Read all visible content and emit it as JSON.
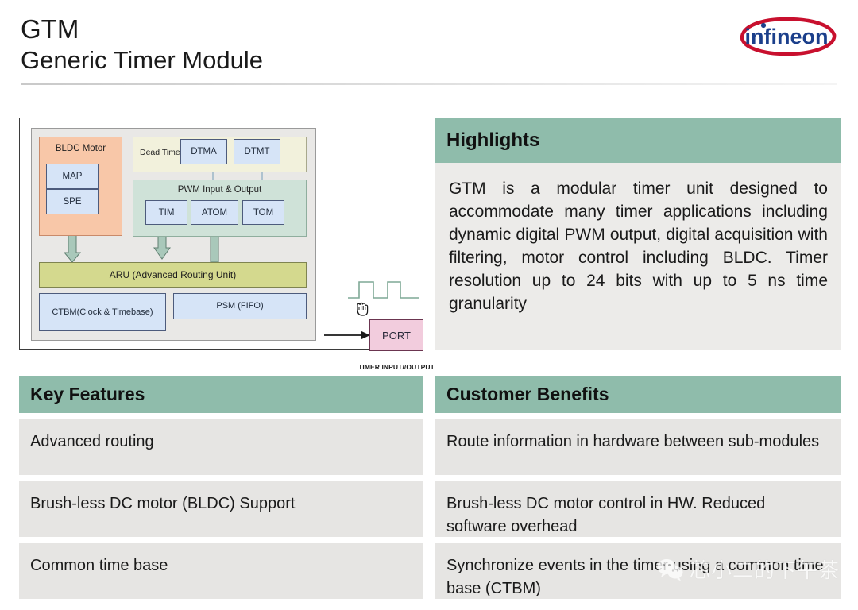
{
  "header": {
    "title_line1": "GTM",
    "title_line2": "Generic Timer Module",
    "logo_text": "infineon"
  },
  "diagram": {
    "bldc_group_label": "BLDC Motor",
    "map_label": "MAP",
    "spe_label": "SPE",
    "deadtime_label": "Dead Time",
    "dtma_label": "DTMA",
    "dtmt_label": "DTMT",
    "pwm_group_label": "PWM Input & Output",
    "tim_label": "TIM",
    "atom_label": "ATOM",
    "tom_label": "TOM",
    "aru_label": "ARU (Advanced Routing Unit)",
    "ctbm_label": "CTBM(Clock & Timebase)",
    "psm_label": "PSM (FIFO)",
    "port_label": "PORT",
    "timer_io_label": "TIMER INPUT//OUTPUT",
    "colors": {
      "bldc_group": "#f8c7a8",
      "deadtime_group": "#f2f1dc",
      "pwm_group": "#cfe2d8",
      "sub_block": "#d6e4f7",
      "aru": "#d4d98e",
      "port": "#f2ccdd",
      "arrow": "#a9c8ba",
      "panel_bg": "#e9e8e6"
    }
  },
  "highlights": {
    "heading": "Highlights",
    "body": "GTM is a modular timer unit designed to accommodate many timer applications including dynamic digital PWM output, digital acquisition with filtering, motor control including BLDC. Timer resolution up to 24 bits with up to 5 ns time granularity"
  },
  "key_features": {
    "heading": "Key Features",
    "rows": [
      "Advanced routing",
      "Brush-less DC motor (BLDC) Support",
      "Common time base"
    ]
  },
  "customer_benefits": {
    "heading": "Customer Benefits",
    "rows": [
      "Route information in hardware between sub-modules",
      "Brush-less DC motor control in HW. Reduced software overhead",
      "Synchronize events in the timer using a common time base (CTBM)"
    ]
  },
  "watermark": {
    "text": "芯小二的下午茶",
    "icon": "wechat-icon"
  },
  "theme": {
    "accent_green": "#8fbcab",
    "body_gray": "#ecebe9",
    "row_gray": "#e6e5e3",
    "logo_blue": "#1b3f8b",
    "logo_red": "#c8102e"
  }
}
